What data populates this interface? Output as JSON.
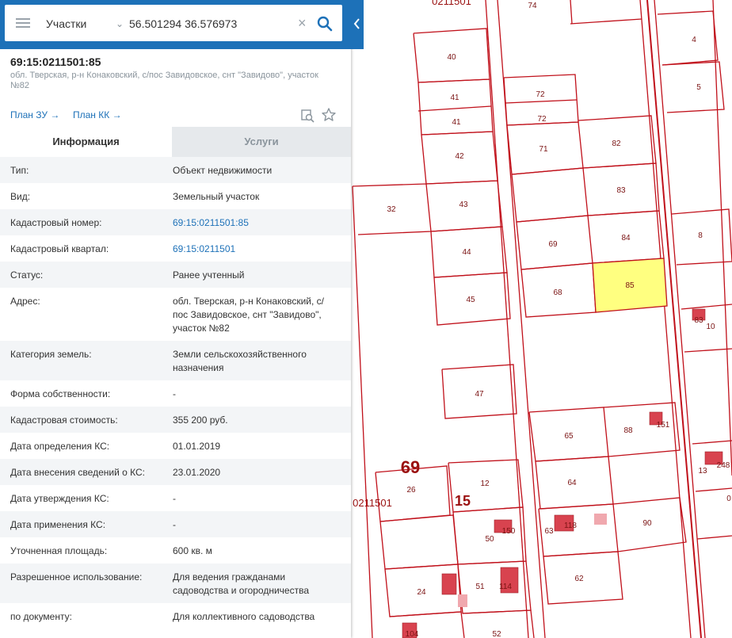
{
  "search": {
    "layer_label": "Участки",
    "query": "56.501294 36.576973"
  },
  "object": {
    "number": "69:15:0211501:85",
    "address": "обл. Тверская, р-н Конаковский, с/пос Завидовское, снт \"Завидово\", участок №82"
  },
  "links": {
    "plan_zu": "План ЗУ →",
    "plan_kk": "План КК →"
  },
  "tabs": [
    "Информация",
    "Услуги"
  ],
  "rows": [
    {
      "label": "Тип:",
      "value": "Объект недвижимости"
    },
    {
      "label": "Вид:",
      "value": "Земельный участок"
    },
    {
      "label": "Кадастровый номер:",
      "value": "69:15:0211501:85"
    },
    {
      "label": "Кадастровый квартал:",
      "value": "69:15:0211501"
    },
    {
      "label": "Статус:",
      "value": "Ранее учтенный"
    },
    {
      "label": "Адрес:",
      "value": "обл. Тверская, р-н Конаковский, с/пос Завидовское, снт \"Завидово\", участок №82"
    },
    {
      "label": "Категория земель:",
      "value": "Земли сельскохозяйственного назначения"
    },
    {
      "label": "Форма собственности:",
      "value": "-"
    },
    {
      "label": "Кадастровая стоимость:",
      "value": "355 200 руб."
    },
    {
      "label": "Дата определения КС:",
      "value": "01.01.2019"
    },
    {
      "label": "Дата внесения сведений о КС:",
      "value": "23.01.2020"
    },
    {
      "label": "Дата утверждения КС:",
      "value": "-"
    },
    {
      "label": "Дата применения КС:",
      "value": "-"
    },
    {
      "label": "Уточненная площадь:",
      "value": "600 кв. м"
    },
    {
      "label": "Разрешенное использование:",
      "value": "Для ведения гражданами садоводства и огородничества"
    },
    {
      "label": "по документу:",
      "value": "Для коллективного садоводства"
    }
  ],
  "map": {
    "colors": {
      "boundary": "#c0101a",
      "highlight": "#ffff80",
      "building": "#d8434f",
      "building_light": "#f0a8ae"
    },
    "parcel_labels": [
      "74",
      "40",
      "4",
      "5",
      "41",
      "41",
      "72",
      "72",
      "71",
      "82",
      "42",
      "83",
      "32",
      "43",
      "69",
      "84",
      "8",
      "44",
      "68",
      "85",
      "45",
      "83",
      "10",
      "47",
      "65",
      "88",
      "151",
      "13",
      "248",
      "26",
      "12",
      "64",
      "0",
      "50",
      "150",
      "63",
      "118",
      "90",
      "24",
      "51",
      "114",
      "62",
      "104",
      "52"
    ],
    "quarter_labels": {
      "region": "69",
      "district": "15",
      "quarter_top": "0211501",
      "quarter_left": "0211501"
    }
  }
}
